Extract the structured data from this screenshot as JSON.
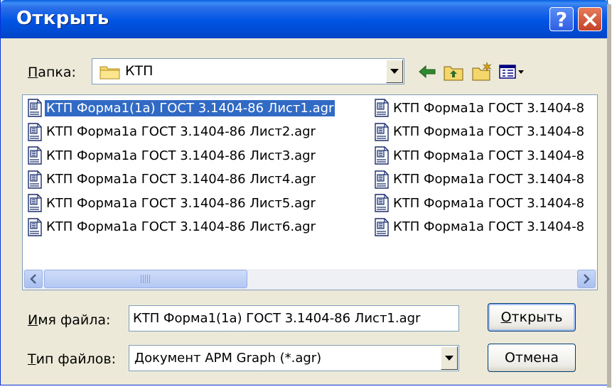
{
  "window": {
    "title": "Открыть"
  },
  "folder": {
    "label_ul": "П",
    "label_rest": "апка:",
    "current": "КТП"
  },
  "files": {
    "left": [
      "КТП Форма1(1а) ГОСТ 3.1404-86 Лист1.agr",
      "КТП Форма1а ГОСТ 3.1404-86 Лист2.agr",
      "КТП Форма1а ГОСТ 3.1404-86 Лист3.agr",
      "КТП Форма1а ГОСТ 3.1404-86 Лист4.agr",
      "КТП Форма1а ГОСТ 3.1404-86 Лист5.agr",
      "КТП Форма1а ГОСТ 3.1404-86 Лист6.agr"
    ],
    "right": [
      "КТП Форма1а ГОСТ 3.1404-8",
      "КТП Форма1а ГОСТ 3.1404-8",
      "КТП Форма1а ГОСТ 3.1404-8",
      "КТП Форма1а ГОСТ 3.1404-8",
      "КТП Форма1а ГОСТ 3.1404-8",
      "КТП Форма1а ГОСТ 3.1404-8"
    ]
  },
  "filename": {
    "label_ul": "И",
    "label_rest": "мя файла:",
    "value": "КТП Форма1(1а) ГОСТ 3.1404-86 Лист1.agr"
  },
  "filetype": {
    "label_ul": "Т",
    "label_rest": "ип файлов:",
    "value": "Документ APM Graph (*.agr)"
  },
  "buttons": {
    "open_ul": "О",
    "open_rest": "ткрыть",
    "cancel": "Отмена"
  },
  "icons": {
    "help": "?",
    "close": "×",
    "folder": "folder-icon",
    "back": "back-arrow-icon",
    "up": "up-folder-icon",
    "new_folder": "new-folder-icon",
    "view": "view-menu-icon",
    "file": "agr-file-icon"
  },
  "colors": {
    "title_bar": "#0054e3",
    "selection": "#316ac5",
    "dialog_bg": "#ece9d8"
  }
}
